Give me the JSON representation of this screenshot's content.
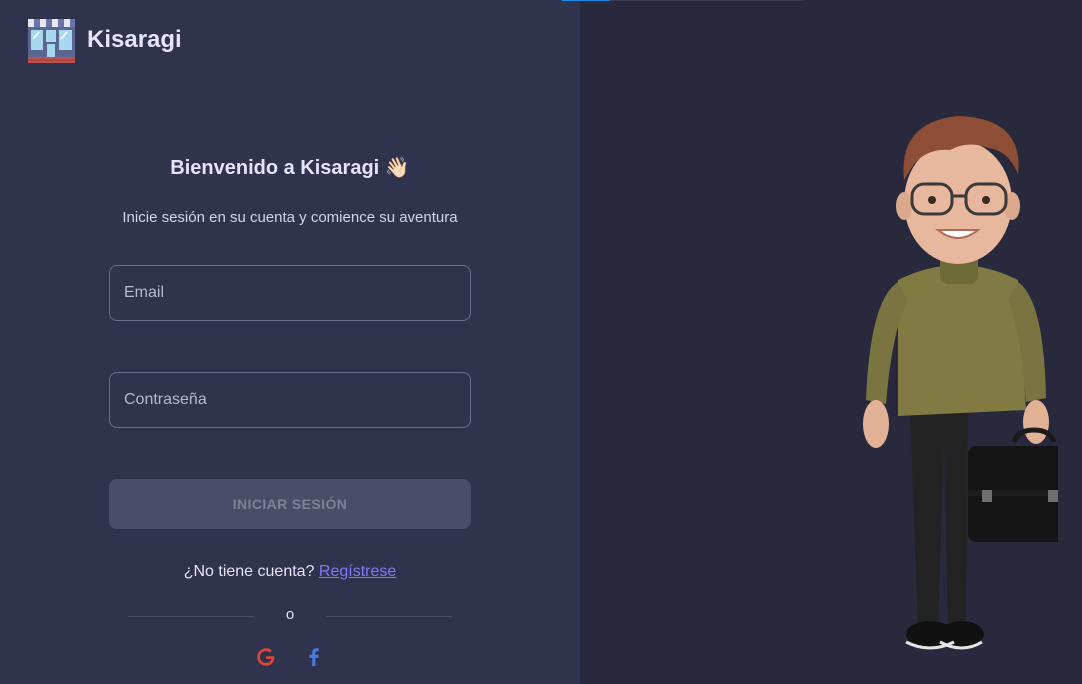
{
  "brand": {
    "name": "Kisaragi",
    "logo_icon": "storefront-icon"
  },
  "login": {
    "title": "Bienvenido a Kisaragi 👋🏻",
    "subtitle": "Inicie sesión en su cuenta y comience su aventura",
    "email_placeholder": "Email",
    "password_placeholder": "Contraseña",
    "submit_label": "INICIAR SESIÓN",
    "no_account_text": "¿No tiene cuenta?",
    "register_link": "Regístrese",
    "divider_text": "o",
    "social": [
      "google-icon",
      "facebook-icon"
    ]
  },
  "colors": {
    "left_panel": "#30334e",
    "right_panel": "#28293d",
    "primary": "#7f79f8",
    "text": "#e7e3fc",
    "progress": "#1e88e5"
  },
  "illustration": {
    "icon": "businessman-illustration"
  },
  "top_progress": {
    "fraction": 0.2
  }
}
